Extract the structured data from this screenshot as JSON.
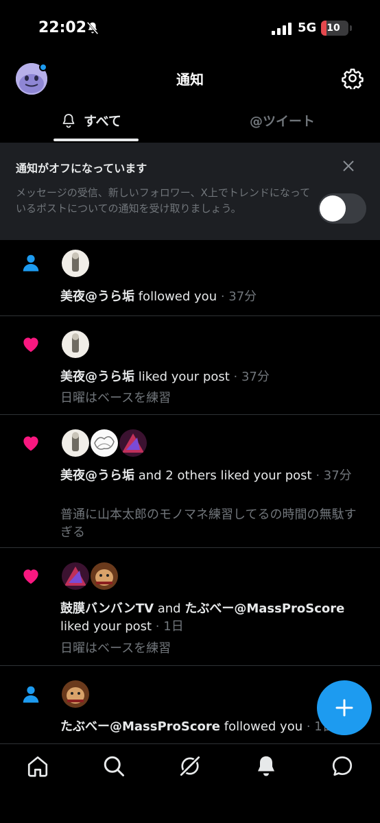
{
  "status_bar": {
    "time": "22:02",
    "network": "5G",
    "battery": "10"
  },
  "header": {
    "title": "通知"
  },
  "tabs": [
    {
      "label": "すべて",
      "active": true
    },
    {
      "label": "@ツイート",
      "active": false
    }
  ],
  "banner": {
    "title": "通知がオフになっています",
    "body": "メッセージの受信、新しいフォロワー、X上でトレンドになっているポストについての通知を受け取りましょう。",
    "toggle_on": false
  },
  "notifications": [
    {
      "type": "follow",
      "name": "美夜@うら垢",
      "action": " followed you",
      "time": " · 37分",
      "snippet": ""
    },
    {
      "type": "like",
      "name": "美夜@うら垢",
      "action": " liked your post",
      "time": " · 37分",
      "snippet": "日曜はベースを練習"
    },
    {
      "type": "like",
      "name": "美夜@うら垢",
      "action": " and 2 others liked your post",
      "time": " · 37分",
      "snippet": "普通に山本太郎のモノマネ練習してるの時間の無駄すぎる"
    },
    {
      "type": "like",
      "name": "鼓膜バンバンTV",
      "conj": " and ",
      "name2": "たぶべー@MassProScore",
      "action": "liked your post",
      "time": " · 1日",
      "snippet": "日曜はベースを練習"
    },
    {
      "type": "follow",
      "name": "たぶべー@MassProScore",
      "action": " followed you",
      "time": " · 1日",
      "snippet": ""
    }
  ],
  "colors": {
    "accent": "#1d9bf0",
    "like": "#f91880",
    "muted": "#71767b"
  }
}
